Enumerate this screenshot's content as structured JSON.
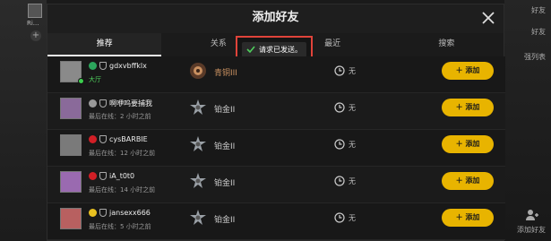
{
  "background": {
    "left_name": "Ri...",
    "left_plus": "+",
    "right_texts": [
      "好友",
      "好友",
      "强列表",
      "添加好友"
    ]
  },
  "dialog": {
    "title": "添加好友",
    "tabs": [
      {
        "label": "推荐",
        "active": true
      },
      {
        "label": "关系",
        "active": false
      },
      {
        "label": "最近",
        "active": false
      },
      {
        "label": "搜索",
        "active": false
      }
    ],
    "toast": "请求已发送。"
  },
  "players": [
    {
      "name": "gdxvbffklx",
      "status": "大厅",
      "status_online": true,
      "flag_color": "#2ca55c",
      "avatar_color": "#8a8a8a",
      "rank": "青铜III",
      "rank_tier": "bronze",
      "recent": "无",
      "add_label": "添加"
    },
    {
      "name": "啊咿呜要捕我",
      "status": "最后在线：2 小时之前",
      "status_online": false,
      "flag_color": "#9a9a9a",
      "avatar_color": "#8a6a9a",
      "rank": "铂金II",
      "rank_tier": "platinum",
      "recent": "无",
      "add_label": "添加"
    },
    {
      "name": "cysBARBIE",
      "status": "最后在线：12 小时之前",
      "status_online": false,
      "flag_color": "#d21f26",
      "avatar_color": "#7a7a7a",
      "rank": "铂金II",
      "rank_tier": "platinum",
      "recent": "无",
      "add_label": "添加"
    },
    {
      "name": "iA_t0t0",
      "status": "最后在线：14 小时之前",
      "status_online": false,
      "flag_color": "#d21f26",
      "avatar_color": "#9a6ab0",
      "rank": "铂金II",
      "rank_tier": "platinum",
      "recent": "无",
      "add_label": "添加"
    },
    {
      "name": "jansexx666",
      "status": "最后在线：5 小时之前",
      "status_online": false,
      "flag_color": "#e8c020",
      "avatar_color": "#b86060",
      "rank": "铂金II",
      "rank_tier": "platinum",
      "recent": "无",
      "add_label": "添加"
    }
  ],
  "colors": {
    "accent": "#e8b400",
    "toast_border": "#e0433a",
    "online": "#4fd05d"
  },
  "icons": {
    "close": "close-icon",
    "check": "check-icon",
    "rank_bronze": "bronze-rank-icon",
    "rank_platinum": "platinum-rank-icon",
    "clock": "clock-icon",
    "plus": "plus-icon",
    "shield": "shield-icon"
  }
}
